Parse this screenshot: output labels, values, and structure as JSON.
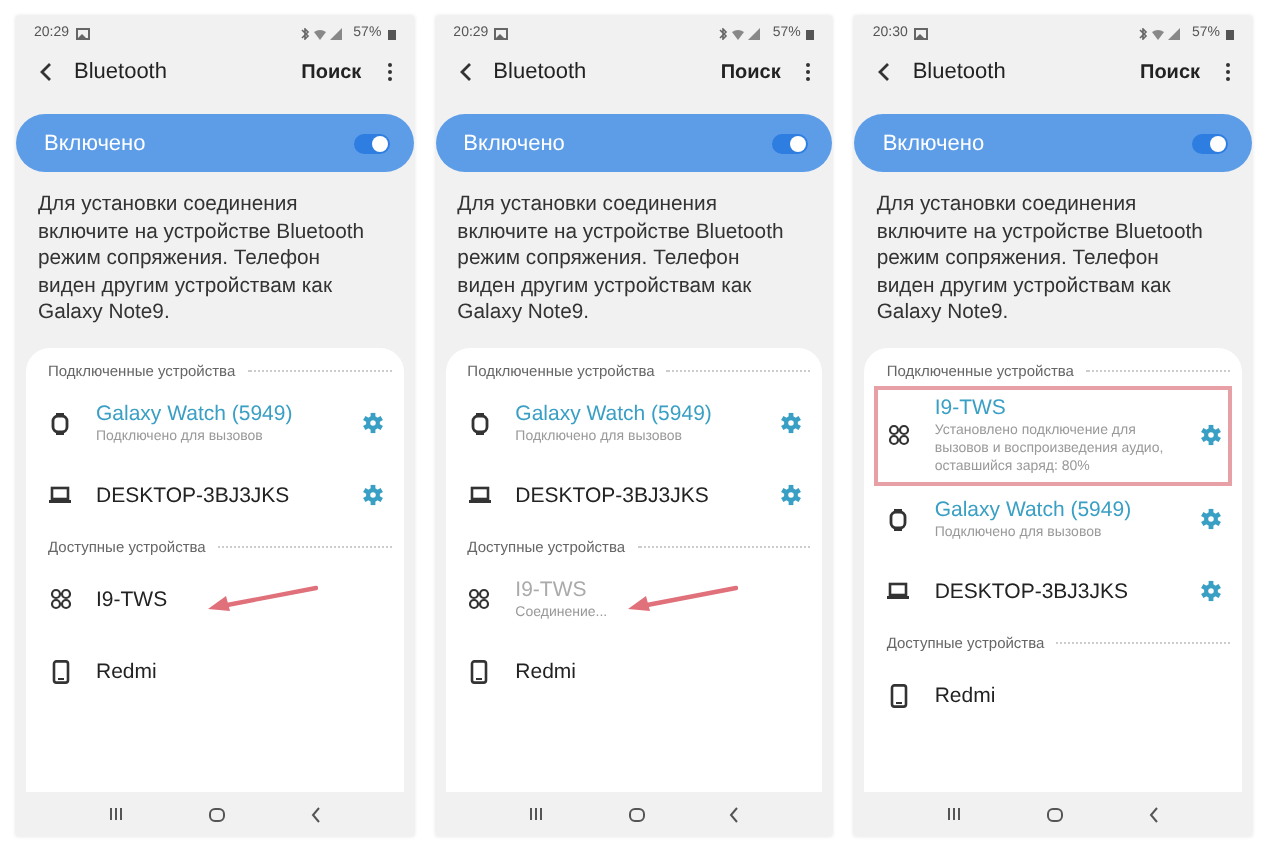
{
  "screens": [
    {
      "status_time": "20:29",
      "battery": "57%",
      "title": "Bluetooth",
      "action": "Поиск",
      "toggle": {
        "label": "Включено",
        "on": true
      },
      "description": "Для установки соединения включите на устройстве Bluetooth режим сопряжения. Телефон виден другим устройствам как Galaxy Note9.",
      "sections": [
        {
          "header": "Подключенные устройства",
          "devices": [
            {
              "kind": "watch",
              "name": "Galaxy Watch (5949)",
              "subtitle": "Подключено для вызовов",
              "connected": true,
              "connecting": false,
              "settings": true,
              "arrow": false,
              "highlighted": false
            },
            {
              "kind": "laptop",
              "name": "DESKTOP-3BJ3JKS",
              "connected": false,
              "connecting": false,
              "settings": true,
              "arrow": false,
              "highlighted": false
            }
          ]
        },
        {
          "header": "Доступные устройства",
          "devices": [
            {
              "kind": "earbuds",
              "name": "I9-TWS",
              "connected": false,
              "connecting": false,
              "settings": false,
              "arrow": true,
              "highlighted": false
            },
            {
              "kind": "phone",
              "name": "Redmi",
              "connected": false,
              "connecting": false,
              "settings": false,
              "arrow": false,
              "highlighted": false
            }
          ]
        }
      ]
    },
    {
      "status_time": "20:29",
      "battery": "57%",
      "title": "Bluetooth",
      "action": "Поиск",
      "toggle": {
        "label": "Включено",
        "on": true
      },
      "description": "Для установки соединения включите на устройстве Bluetooth режим сопряжения. Телефон виден другим устройствам как Galaxy Note9.",
      "sections": [
        {
          "header": "Подключенные устройства",
          "devices": [
            {
              "kind": "watch",
              "name": "Galaxy Watch (5949)",
              "subtitle": "Подключено для вызовов",
              "connected": true,
              "connecting": false,
              "settings": true,
              "arrow": false,
              "highlighted": false
            },
            {
              "kind": "laptop",
              "name": "DESKTOP-3BJ3JKS",
              "connected": false,
              "connecting": false,
              "settings": true,
              "arrow": false,
              "highlighted": false
            }
          ]
        },
        {
          "header": "Доступные устройства",
          "devices": [
            {
              "kind": "earbuds",
              "name": "I9-TWS",
              "subtitle": "Соединение...",
              "connected": false,
              "connecting": true,
              "settings": false,
              "arrow": true,
              "highlighted": false
            },
            {
              "kind": "phone",
              "name": "Redmi",
              "connected": false,
              "connecting": false,
              "settings": false,
              "arrow": false,
              "highlighted": false
            }
          ]
        }
      ]
    },
    {
      "status_time": "20:30",
      "battery": "57%",
      "title": "Bluetooth",
      "action": "Поиск",
      "toggle": {
        "label": "Включено",
        "on": true
      },
      "description": "Для установки соединения включите на устройстве Bluetooth режим сопряжения. Телефон виден другим устройствам как Galaxy Note9.",
      "sections": [
        {
          "header": "Подключенные устройства",
          "devices": [
            {
              "kind": "earbuds",
              "name": "I9-TWS",
              "subtitle": "Установлено подключение для вызовов и воспроизведения аудио, оставшийся заряд: 80%",
              "connected": true,
              "connecting": false,
              "settings": true,
              "arrow": false,
              "highlighted": true
            },
            {
              "kind": "watch",
              "name": "Galaxy Watch (5949)",
              "subtitle": "Подключено для вызовов",
              "connected": true,
              "connecting": false,
              "settings": true,
              "arrow": false,
              "highlighted": false
            },
            {
              "kind": "laptop",
              "name": "DESKTOP-3BJ3JKS",
              "connected": false,
              "connecting": false,
              "settings": true,
              "arrow": false,
              "highlighted": false
            }
          ]
        },
        {
          "header": "Доступные устройства",
          "devices": [
            {
              "kind": "phone",
              "name": "Redmi",
              "connected": false,
              "connecting": false,
              "settings": false,
              "arrow": false,
              "highlighted": false
            }
          ]
        }
      ]
    }
  ]
}
